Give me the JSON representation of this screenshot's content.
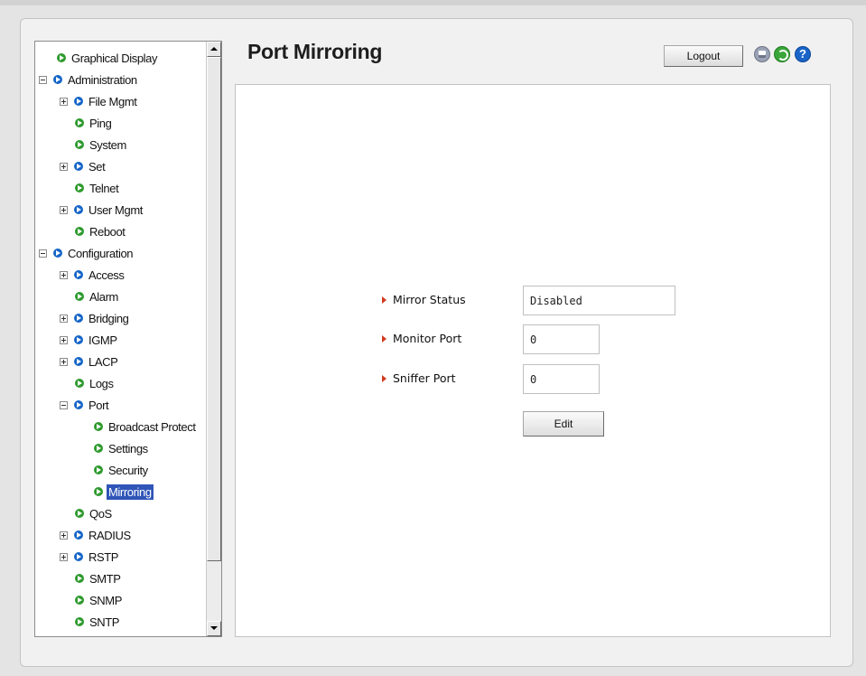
{
  "header": {
    "title": "Port Mirroring",
    "logout_label": "Logout",
    "help_glyph": "?"
  },
  "icons": {
    "save": "save-icon",
    "refresh": "refresh-icon",
    "help": "help-icon"
  },
  "sidebar": {
    "items": [
      {
        "label": "Graphical Display"
      },
      {
        "label": "Administration"
      },
      {
        "label": "File Mgmt"
      },
      {
        "label": "Ping"
      },
      {
        "label": "System"
      },
      {
        "label": "Set"
      },
      {
        "label": "Telnet"
      },
      {
        "label": "User Mgmt"
      },
      {
        "label": "Reboot"
      },
      {
        "label": "Configuration"
      },
      {
        "label": "Access"
      },
      {
        "label": "Alarm"
      },
      {
        "label": "Bridging"
      },
      {
        "label": "IGMP"
      },
      {
        "label": "LACP"
      },
      {
        "label": "Logs"
      },
      {
        "label": "Port"
      },
      {
        "label": "Broadcast Protect"
      },
      {
        "label": "Settings"
      },
      {
        "label": "Security"
      },
      {
        "label": "Mirroring",
        "selected": true
      },
      {
        "label": "QoS"
      },
      {
        "label": "RADIUS"
      },
      {
        "label": "RSTP"
      },
      {
        "label": "SMTP"
      },
      {
        "label": "SNMP"
      },
      {
        "label": "SNTP"
      }
    ]
  },
  "form": {
    "mirror_status": {
      "label": "Mirror Status",
      "value": "Disabled"
    },
    "monitor_port": {
      "label": "Monitor Port",
      "value": "0"
    },
    "sniffer_port": {
      "label": "Sniffer Port",
      "value": "0"
    },
    "edit_label": "Edit"
  },
  "colors": {
    "selection": "#2f55b8",
    "leaf_bullet": "#2e9a2e",
    "folder_bullet": "#1565c8",
    "field_marker": "#d23a1e"
  }
}
